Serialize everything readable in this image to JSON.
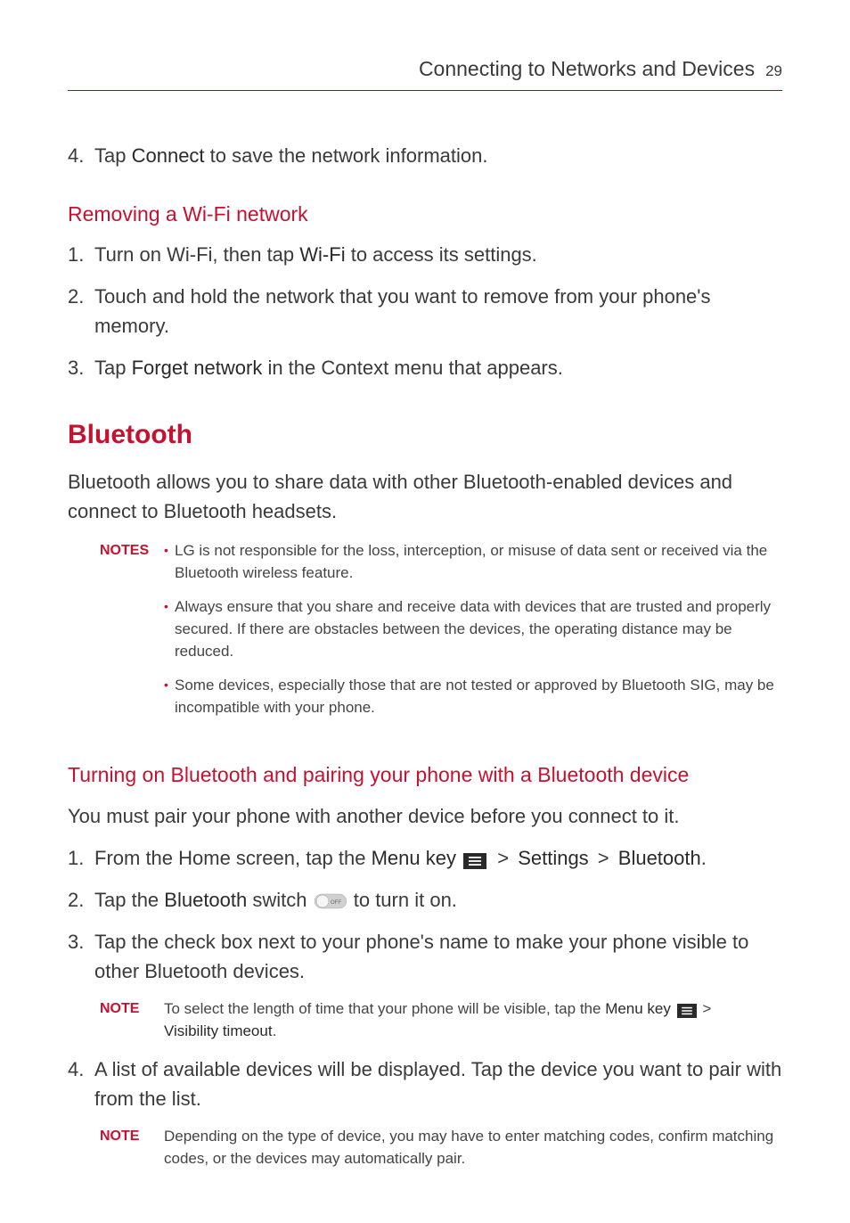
{
  "header": {
    "title": "Connecting to Networks and Devices",
    "page": "29"
  },
  "step4_top": {
    "num": "4.",
    "pre": "Tap ",
    "bold": "Connect",
    "post": " to save the network information."
  },
  "removing": {
    "heading": "Removing a Wi-Fi network",
    "s1": {
      "num": "1.",
      "pre": "Turn on Wi-Fi, then tap ",
      "bold": "Wi-Fi",
      "post": " to access its settings."
    },
    "s2": {
      "num": "2.",
      "text": "Touch and hold the network that you want to remove from your phone's memory."
    },
    "s3": {
      "num": "3.",
      "pre": "Tap ",
      "bold": "Forget network",
      "post": " in the Context menu that appears."
    }
  },
  "bluetooth": {
    "heading": "Bluetooth",
    "intro": "Bluetooth allows you to share data with other Bluetooth-enabled devices and connect to Bluetooth headsets.",
    "notes_label": "NOTES",
    "n1": "LG is not responsible for the loss, interception, or misuse of data sent or received via the Bluetooth wireless feature.",
    "n2": "Always ensure that you share and receive data with devices that are trusted and properly secured. If there are obstacles between the devices, the operating distance may be reduced.",
    "n3": "Some devices, especially those that are not tested or approved by Bluetooth SIG, may be incompatible with your phone."
  },
  "pairing": {
    "heading": "Turning on Bluetooth and pairing your phone with a Bluetooth device",
    "intro": "You must pair your phone with another device before you connect to it.",
    "s1": {
      "num": "1.",
      "pre": "From the Home screen, tap the ",
      "b1": "Menu key",
      "mid1": " > ",
      "b2": "Settings",
      "mid2": " > ",
      "b3": "Bluetooth",
      "post": "."
    },
    "s2": {
      "num": "2.",
      "pre": "Tap the ",
      "b1": "Bluetooth",
      "mid": " switch ",
      "post": " to turn it on."
    },
    "s3": {
      "num": "3.",
      "text": "Tap the check box next to your phone's name to make your phone visible to other Bluetooth devices."
    },
    "note1": {
      "label": "NOTE",
      "pre": "To select the length of time that your phone will be visible, tap the ",
      "b1": "Menu key",
      "mid": " > ",
      "b2": "Visibility timeout",
      "post": "."
    },
    "s4": {
      "num": "4.",
      "text": "A list of available devices will be displayed. Tap the device you want to pair with from the list."
    },
    "note2": {
      "label": "NOTE",
      "text": "Depending on the type of device, you may have to enter matching codes, confirm matching codes, or the devices may automatically pair."
    }
  }
}
